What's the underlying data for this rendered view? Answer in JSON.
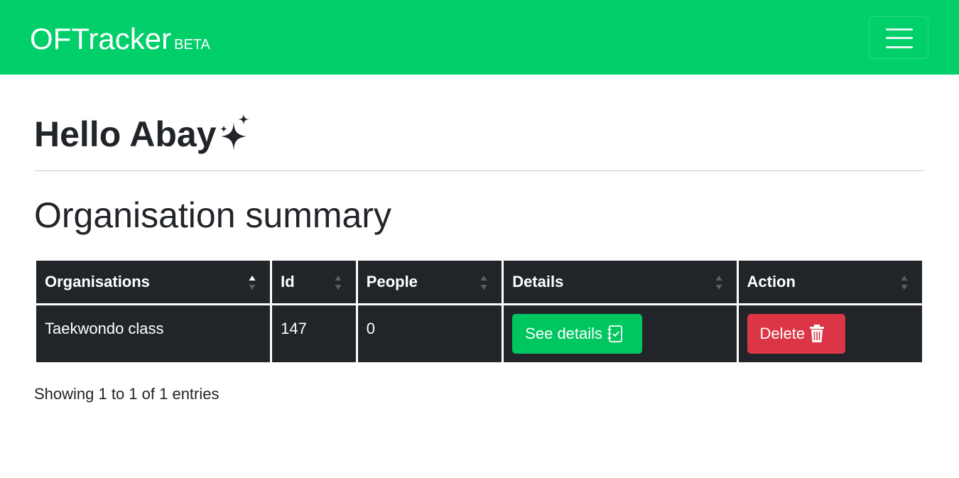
{
  "navbar": {
    "brand": "OFTracker",
    "badge": "BETA",
    "menu_icon": "hamburger-icon"
  },
  "greeting": {
    "text": "Hello Abay",
    "icon": "sparkle-icon"
  },
  "section": {
    "title": "Organisation summary"
  },
  "table": {
    "columns": [
      "Organisations",
      "Id",
      "People",
      "Details",
      "Action"
    ],
    "rows": [
      {
        "organisation": "Taekwondo class",
        "id": "147",
        "people": "0",
        "details_label": "See details",
        "action_label": "Delete"
      }
    ],
    "info": "Showing 1 to 1 of 1 entries"
  },
  "colors": {
    "brand_green": "#00cf6a",
    "button_green": "#00c660",
    "danger_red": "#dc3545",
    "table_dark": "#212529"
  }
}
